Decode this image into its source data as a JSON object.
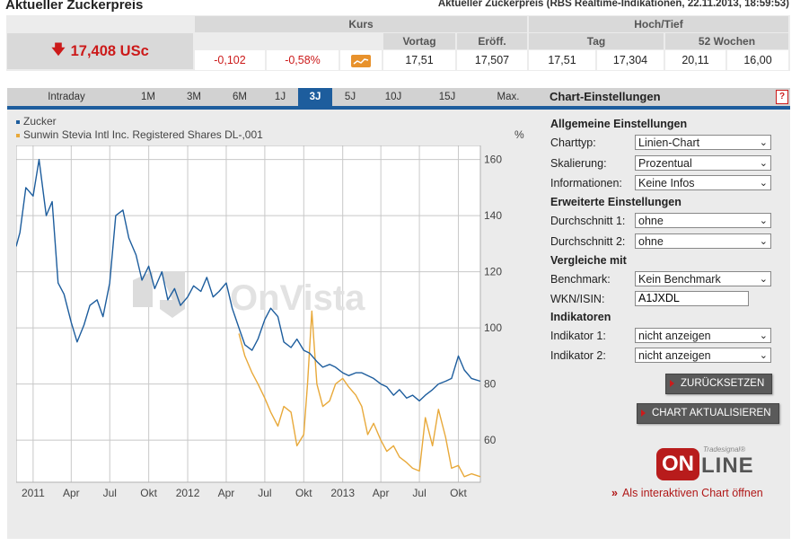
{
  "header": {
    "title": "Aktueller Zuckerpreis",
    "subtitle": "Aktueller Zuckerpreis (RBS Realtime-Indikationen, 22.11.2013, 18:59:53)"
  },
  "quote": {
    "price": "17,408 USc",
    "kurs_label": "Kurs",
    "hochtief_label": "Hoch/Tief",
    "vortag_label": "Vortag",
    "eroeff_label": "Eröff.",
    "tag_label": "Tag",
    "wochen_label": "52 Wochen",
    "change_abs": "-0,102",
    "change_pct": "-0,58%",
    "vortag": "17,51",
    "eroeff": "17,507",
    "tag_hoch": "17,51",
    "tag_tief": "17,304",
    "wochen_hoch": "20,11",
    "wochen_tief": "16,00"
  },
  "tabs": [
    "Intraday",
    "1M",
    "3M",
    "6M",
    "1J",
    "3J",
    "5J",
    "10J",
    "15J",
    "Max."
  ],
  "active_tab": "3J",
  "settings": {
    "header": "Chart-Einstellungen",
    "help": "?",
    "allgemein": "Allgemeine Einstellungen",
    "charttyp_label": "Charttyp:",
    "charttyp_value": "Linien-Chart",
    "skalierung_label": "Skalierung:",
    "skalierung_value": "Prozentual",
    "informationen_label": "Informationen:",
    "informationen_value": "Keine Infos",
    "erweitert": "Erweiterte Einstellungen",
    "durchschnitt1_label": "Durchschnitt 1:",
    "durchschnitt1_value": "ohne",
    "durchschnitt2_label": "Durchschnitt 2:",
    "durchschnitt2_value": "ohne",
    "vergleiche": "Vergleiche mit",
    "benchmark_label": "Benchmark:",
    "benchmark_value": "Kein Benchmark",
    "wkn_label": "WKN/ISIN:",
    "wkn_value": "A1JXDL",
    "indikatoren": "Indikatoren",
    "indikator1_label": "Indikator 1:",
    "indikator1_value": "nicht anzeigen",
    "indikator2_label": "Indikator 2:",
    "indikator2_value": "nicht anzeigen",
    "reset_button": "ZURÜCKSETZEN",
    "update_button": "CHART AKTUALISIEREN",
    "logo_sup": "Tradesignal®",
    "logo_on": "ON",
    "logo_line": "LINE",
    "interactive_link": "Als interaktiven Chart öffnen",
    "interactive_marker": "»"
  },
  "watermark": "OnVista",
  "chart_data": {
    "type": "line",
    "ylabel": "%",
    "ylim": [
      45,
      165
    ],
    "yticks": [
      60,
      80,
      100,
      120,
      140,
      160
    ],
    "xtick_labels": [
      "2011",
      "Apr",
      "Jul",
      "Okt",
      "2012",
      "Apr",
      "Jul",
      "Okt",
      "2013",
      "Apr",
      "Jul",
      "Okt"
    ],
    "xlim": [
      "2010-11-22",
      "2013-11-22"
    ],
    "colors": {
      "zucker": "#1d5d9d",
      "stevia": "#e8a93a"
    },
    "series": [
      {
        "name": "Zucker",
        "x": [
          "2010-11-22",
          "2010-12-01",
          "2010-12-15",
          "2011-01-01",
          "2011-01-15",
          "2011-02-01",
          "2011-02-15",
          "2011-03-01",
          "2011-03-15",
          "2011-04-01",
          "2011-04-15",
          "2011-05-01",
          "2011-05-15",
          "2011-06-01",
          "2011-06-15",
          "2011-07-01",
          "2011-07-15",
          "2011-08-01",
          "2011-08-15",
          "2011-09-01",
          "2011-09-15",
          "2011-10-01",
          "2011-10-15",
          "2011-11-01",
          "2011-11-15",
          "2011-12-01",
          "2011-12-15",
          "2012-01-01",
          "2012-01-15",
          "2012-02-01",
          "2012-02-15",
          "2012-03-01",
          "2012-03-15",
          "2012-04-01",
          "2012-04-15",
          "2012-05-01",
          "2012-05-15",
          "2012-06-01",
          "2012-06-15",
          "2012-07-01",
          "2012-07-15",
          "2012-08-01",
          "2012-08-15",
          "2012-09-01",
          "2012-09-15",
          "2012-10-01",
          "2012-10-15",
          "2012-11-01",
          "2012-11-15",
          "2012-12-01",
          "2012-12-15",
          "2013-01-01",
          "2013-01-15",
          "2013-02-01",
          "2013-02-15",
          "2013-03-01",
          "2013-03-15",
          "2013-04-01",
          "2013-04-15",
          "2013-05-01",
          "2013-05-15",
          "2013-06-01",
          "2013-06-15",
          "2013-07-01",
          "2013-07-15",
          "2013-08-01",
          "2013-08-15",
          "2013-09-01",
          "2013-09-15",
          "2013-10-01",
          "2013-10-15",
          "2013-11-01",
          "2013-11-22"
        ],
        "values": [
          129,
          134,
          150,
          147,
          160,
          140,
          145,
          116,
          112,
          102,
          95,
          101,
          108,
          110,
          104,
          116,
          140,
          142,
          132,
          126,
          117,
          122,
          114,
          120,
          110,
          114,
          108,
          111,
          115,
          113,
          118,
          111,
          113,
          116,
          107,
          100,
          94,
          92,
          96,
          103,
          107,
          104,
          95,
          93,
          96,
          92,
          91,
          88,
          86,
          87,
          86,
          84,
          83,
          84,
          84,
          83,
          82,
          80,
          79,
          76,
          78,
          75,
          76,
          74,
          76,
          78,
          80,
          81,
          82,
          90,
          85,
          82,
          81
        ]
      },
      {
        "name": "Sunwin Stevia Intl Inc. Registered Shares DL-,001",
        "x": [
          "2012-05-01",
          "2012-05-15",
          "2012-06-01",
          "2012-06-15",
          "2012-07-01",
          "2012-07-15",
          "2012-08-01",
          "2012-08-15",
          "2012-09-01",
          "2012-09-15",
          "2012-10-01",
          "2012-10-10",
          "2012-10-20",
          "2012-11-01",
          "2012-11-15",
          "2012-12-01",
          "2012-12-15",
          "2013-01-01",
          "2013-01-15",
          "2013-02-01",
          "2013-02-15",
          "2013-03-01",
          "2013-03-15",
          "2013-04-01",
          "2013-04-15",
          "2013-05-01",
          "2013-05-15",
          "2013-06-01",
          "2013-06-15",
          "2013-07-01",
          "2013-07-15",
          "2013-08-01",
          "2013-08-15",
          "2013-09-01",
          "2013-09-15",
          "2013-10-01",
          "2013-10-15",
          "2013-11-01",
          "2013-11-22"
        ],
        "values": [
          98,
          90,
          84,
          80,
          75,
          70,
          65,
          72,
          70,
          58,
          62,
          80,
          106,
          80,
          72,
          74,
          80,
          82,
          79,
          76,
          72,
          62,
          66,
          60,
          56,
          58,
          54,
          52,
          50,
          49,
          68,
          58,
          71,
          61,
          50,
          51,
          47,
          48,
          47
        ]
      }
    ]
  }
}
